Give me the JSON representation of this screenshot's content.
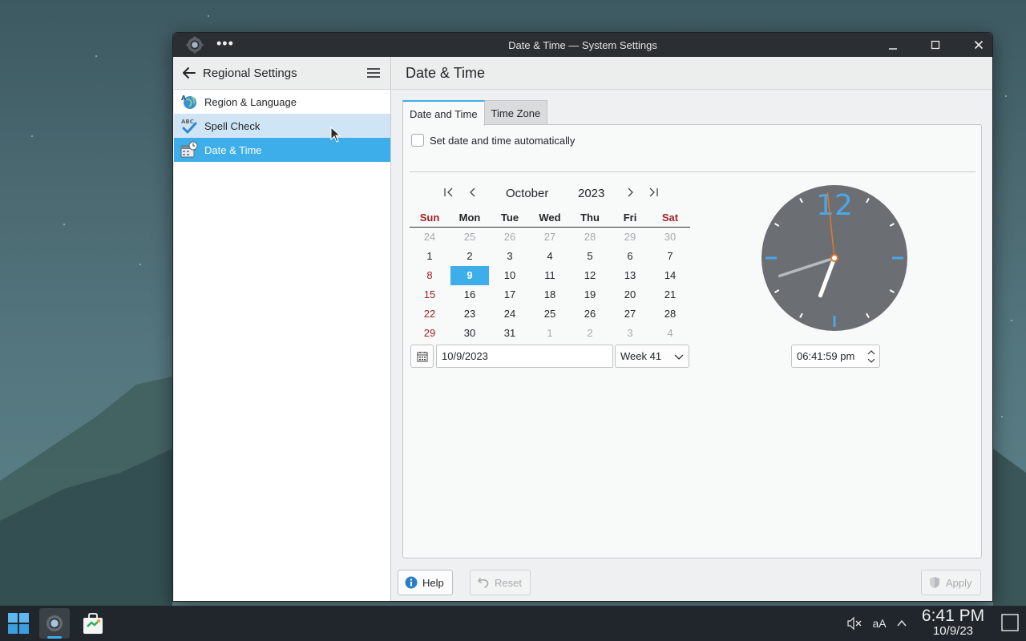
{
  "window": {
    "title": "Date & Time — System Settings",
    "more_label": "•••"
  },
  "sidebar": {
    "header_title": "Regional Settings",
    "items": [
      {
        "label": "Region & Language"
      },
      {
        "label": "Spell Check",
        "icon_text": "ABC"
      },
      {
        "label": "Date & Time"
      }
    ]
  },
  "main": {
    "page_title": "Date & Time",
    "tabs": [
      "Date and Time",
      "Time Zone"
    ],
    "auto_label": "Set date and time automatically",
    "auto_checked": false
  },
  "calendar": {
    "month": "October",
    "year": "2023",
    "weekdays": [
      "Sun",
      "Mon",
      "Tue",
      "Wed",
      "Thu",
      "Fri",
      "Sat"
    ],
    "weeks": [
      [
        "24",
        "25",
        "26",
        "27",
        "28",
        "29",
        "30"
      ],
      [
        "1",
        "2",
        "3",
        "4",
        "5",
        "6",
        "7"
      ],
      [
        "8",
        "9",
        "10",
        "11",
        "12",
        "13",
        "14"
      ],
      [
        "15",
        "16",
        "17",
        "18",
        "19",
        "20",
        "21"
      ],
      [
        "22",
        "23",
        "24",
        "25",
        "26",
        "27",
        "28"
      ],
      [
        "29",
        "30",
        "31",
        "1",
        "2",
        "3",
        "4"
      ]
    ],
    "selected_day": "9",
    "date_value": "10/9/2023",
    "week_value": "Week 41"
  },
  "clock": {
    "twelve_label": "12",
    "time_value": "06:41:59 pm",
    "hour": 6,
    "minute": 41,
    "second": 59
  },
  "buttons": {
    "help": "Help",
    "reset": "Reset",
    "apply": "Apply"
  },
  "taskbar": {
    "time": "6:41 PM",
    "date": "10/9/23",
    "font_size_label": "aA"
  },
  "colors": {
    "accent": "#3daee9",
    "weekend": "#a0222a",
    "titlebar": "#2b2e33",
    "clock_face": "#6b6f73",
    "second_hand": "#e0762b"
  }
}
